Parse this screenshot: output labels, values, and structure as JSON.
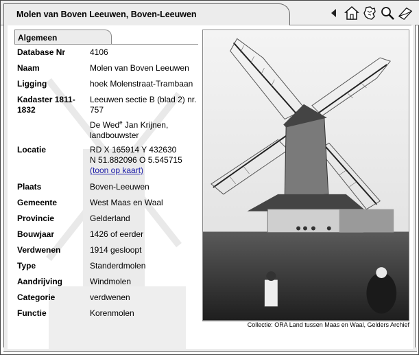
{
  "window": {
    "title": "Molen van Boven Leeuwen, Boven-Leeuwen"
  },
  "toolbar": {
    "icons": [
      "back-arrow-icon",
      "home-icon",
      "map-icon",
      "search-icon",
      "mail-icon"
    ]
  },
  "tab": {
    "label": "Algemeen"
  },
  "fields": [
    {
      "label": "Database Nr",
      "value": "4106"
    },
    {
      "label": "Naam",
      "value": "Molen van Boven Leeuwen"
    },
    {
      "label": "Ligging",
      "value": "hoek Molenstraat-Trambaan"
    },
    {
      "label": "Kadaster 1811-1832",
      "value": "Leeuwen sectie B (blad 2) nr. 757"
    },
    {
      "label": "",
      "value_owner_prefix": "De Wed",
      "value_owner_sup": "e",
      "value_owner_rest": " Jan Krijnen, landbouwster"
    },
    {
      "label": "Locatie",
      "value_rd": "RD X 165914 Y 432630",
      "value_nwse": "N 51.882096 O 5.545715",
      "link": "(toon op kaart)"
    },
    {
      "label": "Plaats",
      "value": "Boven-Leeuwen"
    },
    {
      "label": "Gemeente",
      "value": "West Maas en Waal"
    },
    {
      "label": "Provincie",
      "value": "Gelderland"
    },
    {
      "label": "Bouwjaar",
      "value": "1426 of eerder"
    },
    {
      "label": "Verdwenen",
      "value": "1914 gesloopt"
    },
    {
      "label": "Type",
      "value": "Standerdmolen"
    },
    {
      "label": "Aandrijving",
      "value": "Windmolen"
    },
    {
      "label": "Categorie",
      "value": "verdwenen"
    },
    {
      "label": "Functie",
      "value": "Korenmolen"
    }
  ],
  "photo": {
    "caption": "Collectie: ORA Land tussen Maas en Waal, Gelders Archief"
  }
}
